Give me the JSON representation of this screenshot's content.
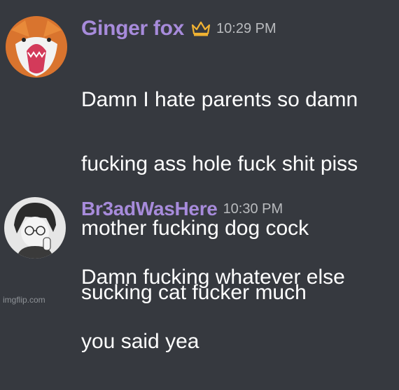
{
  "messages": [
    {
      "username": "Ginger fox",
      "badge_icon": "crown-icon",
      "badge_color": "#f0b232",
      "timestamp": "10:29 PM",
      "lines": [
        "Damn I hate parents so damn",
        "fucking ass hole fuck shit piss",
        "mother fucking dog cock",
        "sucking cat fucker much"
      ]
    },
    {
      "username": "Br3adWasHere",
      "timestamp": "10:30 PM",
      "lines": [
        "Damn fucking whatever else",
        "you said yea"
      ]
    }
  ],
  "colors": {
    "background": "#36393f",
    "username": "#a78bdb",
    "text": "#ffffff",
    "timestamp": "#b9bbbe"
  },
  "watermark": "imgflip.com"
}
